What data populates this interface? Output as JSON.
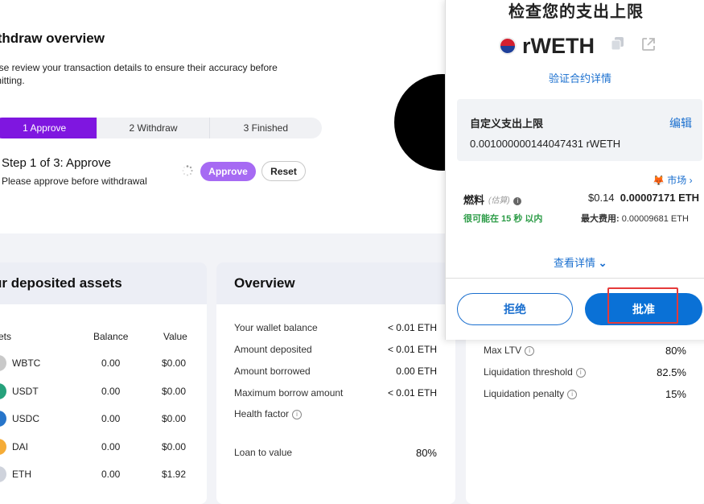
{
  "withdraw": {
    "title": "ithdraw overview",
    "desc": "ase review your transaction details to ensure their accuracy before mitting.",
    "steps": [
      "1 Approve",
      "2 Withdraw",
      "3 Finished"
    ],
    "step_heading": "Step 1 of 3: Approve",
    "step_desc": "Please approve before withdrawal",
    "approve_label": "Approve",
    "reset_label": "Reset"
  },
  "assets": {
    "title": "ur deposited assets",
    "headers": [
      "sets",
      "Balance",
      "Value"
    ],
    "rows": [
      {
        "symbol": "WBTC",
        "balance": "0.00",
        "value": "$0.00",
        "color": "#c9c9c9"
      },
      {
        "symbol": "USDT",
        "balance": "0.00",
        "value": "$0.00",
        "color": "#26a17b"
      },
      {
        "symbol": "USDC",
        "balance": "0.00",
        "value": "$0.00",
        "color": "#2775ca"
      },
      {
        "symbol": "DAI",
        "balance": "0.00",
        "value": "$0.00",
        "color": "#f5ac37"
      },
      {
        "symbol": "ETH",
        "balance": "0.00",
        "value": "$1.92",
        "color": "#cfd3dc"
      }
    ]
  },
  "overview": {
    "title": "Overview",
    "rows": [
      {
        "label": "Your wallet balance",
        "value": "< 0.01 ETH"
      },
      {
        "label": "Amount deposited",
        "value": "< 0.01 ETH"
      },
      {
        "label": "Amount borrowed",
        "value": "0.00 ETH"
      },
      {
        "label": "Maximum borrow amount",
        "value": "< 0.01 ETH"
      },
      {
        "label": "Health factor",
        "value": ""
      }
    ],
    "ltv_label": "Loan to value",
    "ltv_value": "80%"
  },
  "risk": {
    "rows": [
      {
        "label": "Max LTV",
        "value": "80%"
      },
      {
        "label": "Liquidation threshold",
        "value": "82.5%"
      },
      {
        "label": "Liquidation penalty",
        "value": "15%"
      }
    ]
  },
  "popup": {
    "title": "检查您的支出上限",
    "token": "rWETH",
    "verify_link": "验证合约详情",
    "limit_label": "自定义支出上限",
    "edit_label": "编辑",
    "limit_value": "0.001000000144047431 rWETH",
    "market_label": "市场",
    "fuel_label": "燃料",
    "estimate_label": "(估算)",
    "fee_usd": "$0.14",
    "fee_eth": "0.00007171 ETH",
    "time_label": "很可能在 15 秒 以内",
    "max_fee_label": "最大费用:",
    "max_fee_value": "0.00009681 ETH",
    "details_link": "查看详情",
    "reject_label": "拒绝",
    "approve_label": "批准"
  }
}
